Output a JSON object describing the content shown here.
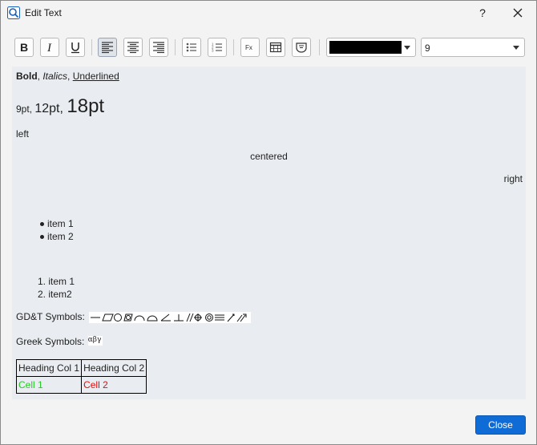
{
  "window": {
    "title": "Edit Text",
    "help": "?"
  },
  "toolbar": {
    "font_color": "#000000",
    "font_size": "9",
    "buttons": [
      "bold",
      "italic",
      "underline",
      "align-left",
      "align-center",
      "align-right",
      "bullet-list",
      "numbered-list",
      "formula",
      "table",
      "symbol"
    ]
  },
  "content": {
    "line1": {
      "bold": "Bold",
      "sep1": ", ",
      "italic": "Italics",
      "sep2": ", ",
      "underline": "Underlined"
    },
    "sizes": {
      "s9": "9pt",
      "sep1": ", ",
      "s12": "12pt",
      "sep2": ", ",
      "s18": "18pt"
    },
    "left": "left",
    "centered": "centered",
    "right": "right",
    "bullets": [
      "item 1",
      "item 2"
    ],
    "numbered": [
      {
        "num": "1.",
        "text": "item 1"
      },
      {
        "num": "2.",
        "text": "item2"
      }
    ],
    "gdt_label": "GD&T Symbols:",
    "greek_label": "Greek Symbols:",
    "greek_symbols": "αβγ",
    "table": {
      "headers": [
        "Heading Col 1",
        "Heading Col 2"
      ],
      "cells": [
        "Cell 1",
        "Cell 2"
      ],
      "cell_colors": [
        "#22cc22",
        "#e01010"
      ]
    }
  },
  "footer": {
    "close_label": "Close"
  },
  "colors": {
    "accent": "#0f6cd6",
    "editor_bg": "#e9ecf0"
  }
}
